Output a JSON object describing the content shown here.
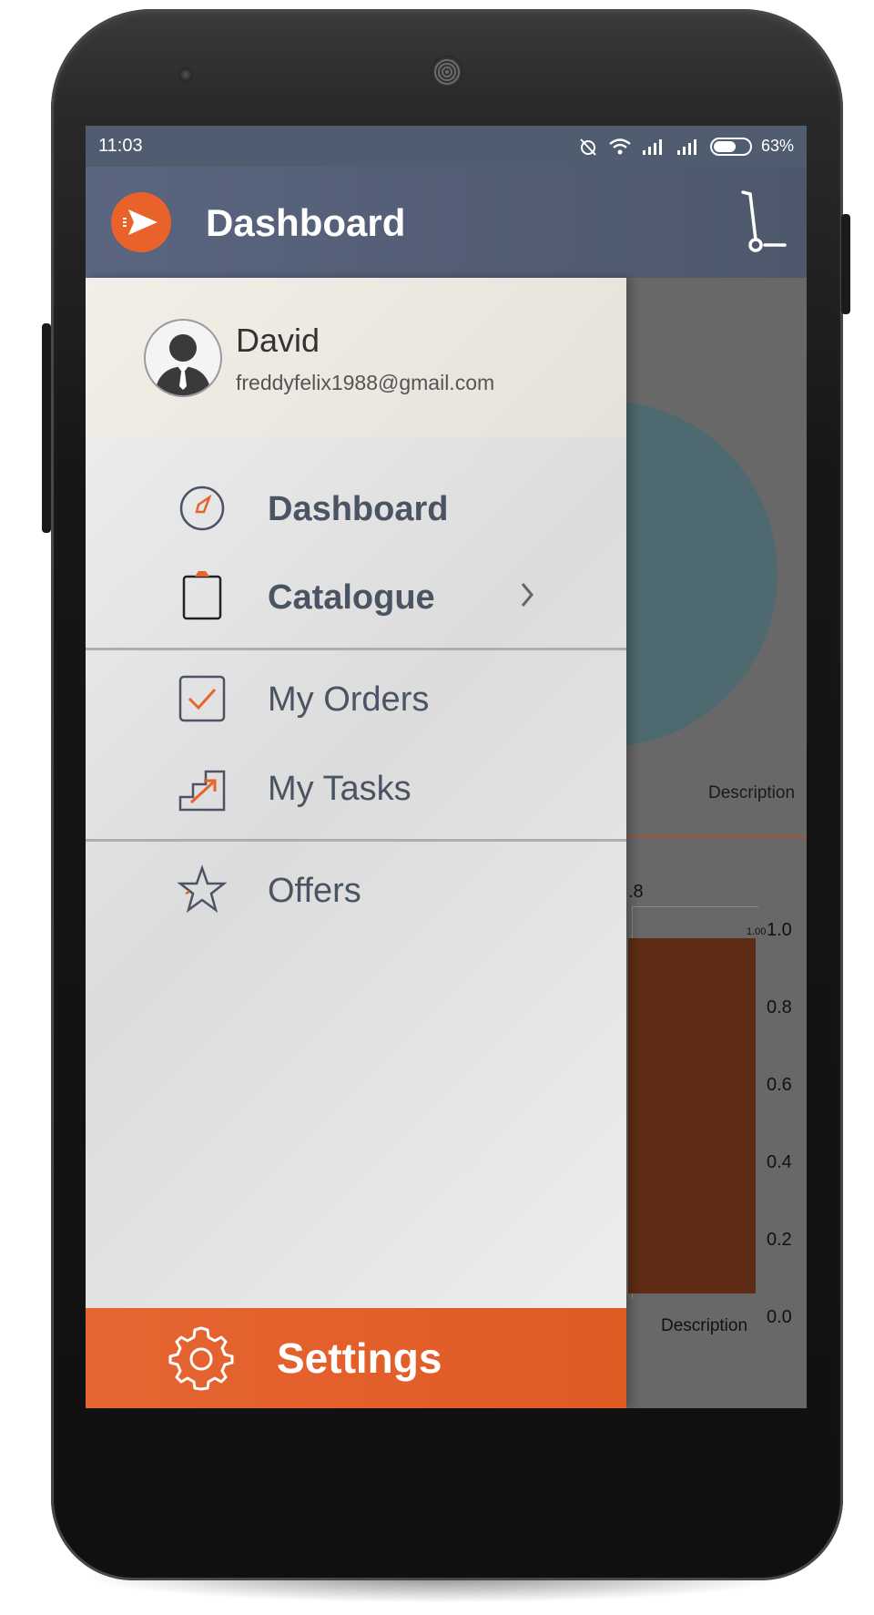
{
  "status_bar": {
    "time": "11:03",
    "battery_percent": "63%",
    "battery_level": 0.63
  },
  "app_bar": {
    "title": "Dashboard",
    "logo_icon": "paper-plane-icon",
    "action_icon": "hand-truck-icon"
  },
  "drawer": {
    "user": {
      "name": "David",
      "email": "freddyfelix1988@gmail.com"
    },
    "items": [
      {
        "label": "Dashboard",
        "icon": "compass-icon",
        "bold": true
      },
      {
        "label": "Catalogue",
        "icon": "clipboard-icon",
        "bold": true,
        "has_submenu": true
      },
      {
        "label": "My Orders",
        "icon": "checkbox-icon",
        "bold": false
      },
      {
        "label": "My Tasks",
        "icon": "stairs-arrow-icon",
        "bold": false
      },
      {
        "label": "Offers",
        "icon": "star-icon",
        "bold": false
      }
    ],
    "settings": {
      "label": "Settings",
      "icon": "gear-icon"
    }
  },
  "background": {
    "desc_top": "Description",
    "partial_label": ".8",
    "bar_value_label": "1.00",
    "axis_ticks": [
      "1.0",
      "0.8",
      "0.6",
      "0.4",
      "0.2",
      "0.0"
    ],
    "desc_bottom": "Description"
  },
  "colors": {
    "accent": "#e8622a",
    "app_bar": "#505c70",
    "text_dark": "#4a5463"
  }
}
